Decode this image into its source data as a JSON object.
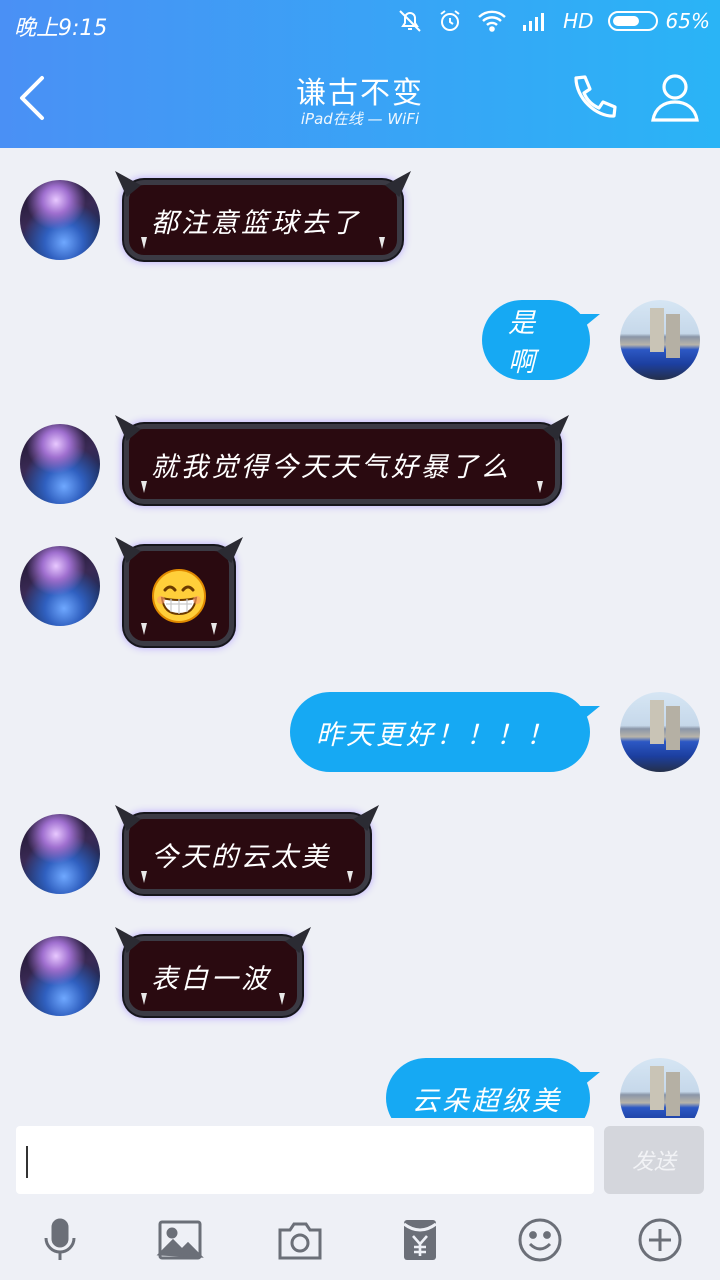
{
  "status_bar": {
    "time": "晚上9:15",
    "network": "HD",
    "battery_percent": "65%",
    "battery_level": 0.65
  },
  "nav": {
    "title": "谦古不变",
    "subtitle": "iPad在线 — WiFi",
    "back_icon": "chevron-left-icon",
    "call_icon": "phone-icon",
    "profile_icon": "person-icon"
  },
  "messages": [
    {
      "side": "in",
      "text": "都注意篮球去了"
    },
    {
      "side": "out",
      "text": "是啊"
    },
    {
      "side": "in",
      "text": "就我觉得今天天气好暴了么"
    },
    {
      "side": "in",
      "emoji": "grinning-face-icon"
    },
    {
      "side": "out",
      "text": "昨天更好！！！！"
    },
    {
      "side": "in",
      "text": "今天的云太美"
    },
    {
      "side": "in",
      "text": "表白一波"
    },
    {
      "side": "out",
      "text": "云朵超级美"
    }
  ],
  "input": {
    "value": "",
    "send_label": "发送"
  },
  "toolbar": {
    "icons": [
      "microphone-icon",
      "image-icon",
      "camera-icon",
      "red-packet-icon",
      "emoji-icon",
      "plus-icon"
    ]
  },
  "colors": {
    "header_start": "#4a90f5",
    "header_end": "#2ab4f6",
    "bubble_out": "#16a9f3",
    "bubble_in": "#2a0a10",
    "background": "#eef0f6"
  }
}
